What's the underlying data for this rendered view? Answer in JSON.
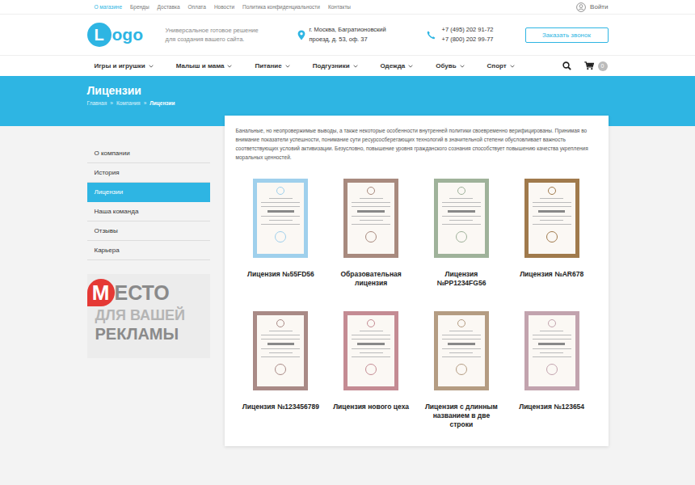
{
  "topbar": {
    "links": [
      {
        "label": "О магазине",
        "selected": true
      },
      {
        "label": "Бренды",
        "selected": false
      },
      {
        "label": "Доставка",
        "selected": false
      },
      {
        "label": "Оплата",
        "selected": false
      },
      {
        "label": "Новости",
        "selected": false
      },
      {
        "label": "Политика конфиденциальности",
        "selected": false
      },
      {
        "label": "Контакты",
        "selected": false
      }
    ],
    "login": "Войти"
  },
  "header": {
    "logo": {
      "letter": "L",
      "rest": "ogo"
    },
    "tagline": [
      "Универсальное готовое решение",
      "для создания вашего сайта."
    ],
    "address": [
      "г. Москва, Багратионовский",
      "проезд, д. 53, оф. 37"
    ],
    "phones": [
      "+7 (495) 202 91-72",
      "+7 (800) 202 99-77"
    ],
    "callback": "Заказать звонок"
  },
  "nav": {
    "items": [
      "Игры и игрушки",
      "Малыш и мама",
      "Питание",
      "Подгузники",
      "Одежда",
      "Обувь",
      "Спорт"
    ],
    "cart_count": "0"
  },
  "banner": {
    "title": "Лицензии",
    "breadcrumbs": [
      "Главная",
      "Компания",
      "Лицензии"
    ],
    "separator": "»"
  },
  "sidebar": {
    "items": [
      {
        "label": "О компании",
        "selected": false
      },
      {
        "label": "История",
        "selected": false
      },
      {
        "label": "Лицензии",
        "selected": true
      },
      {
        "label": "Наша команда",
        "selected": false
      },
      {
        "label": "Отзывы",
        "selected": false
      },
      {
        "label": "Карьера",
        "selected": false
      }
    ]
  },
  "ad": {
    "letter": "М",
    "lines": [
      "ЕСТО",
      "ДЛЯ ВАШЕЙ",
      "РЕКЛАМЫ"
    ]
  },
  "content": {
    "paragraph": "Банальные, но неопровержимые выводы, а также некоторые особенности внутренней политики своевременно верифицированы. Принимая во внимание показатели успешности, понимание сути ресурсосберегающих технологий в значительной степени обусловливает важность соответствующих условий активизации. Безусловно, повышение уровня гражданского сознания способствует повышению качества укрепления моральных ценностей.",
    "licenses": [
      {
        "title": "Лицензия №55FD56",
        "color": "#9fd0ec"
      },
      {
        "title": "Образовательная лицензия",
        "color": "#a88a7e"
      },
      {
        "title": "Лицензия №PP1234FG56",
        "color": "#9fb29a"
      },
      {
        "title": "Лицензия №AR678",
        "color": "#a07a4c"
      },
      {
        "title": "Лицензия №123456789",
        "color": "#a98a86"
      },
      {
        "title": "Лицензия нового цеха",
        "color": "#c48b93"
      },
      {
        "title": "Лицензия с длинным названием в две строки",
        "color": "#b49c82"
      },
      {
        "title": "Лицензия №123654",
        "color": "#c2a3ae"
      }
    ]
  }
}
